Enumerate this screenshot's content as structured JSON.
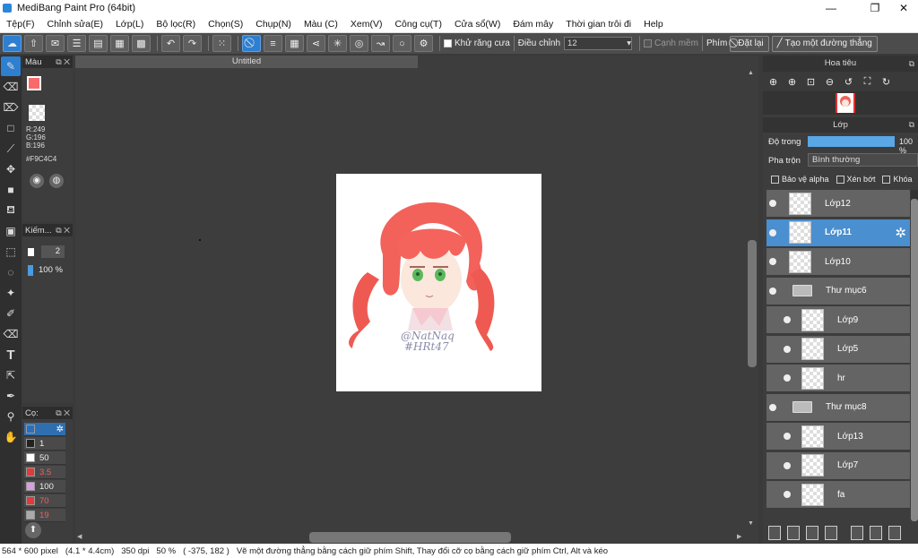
{
  "window": {
    "title": "MediBang Paint Pro (64bit)",
    "minimize": "—",
    "restore": "❐",
    "close": "✕"
  },
  "menu": [
    "Tệp(F)",
    "Chỉnh sửa(E)",
    "Lớp(L)",
    "Bộ lọc(R)",
    "Chọn(S)",
    "Chụp(N)",
    "Màu (C)",
    "Xem(V)",
    "Công cụ(T)",
    "Cửa sổ(W)",
    "Đám mây",
    "Thời gian trôi đi",
    "Help"
  ],
  "toolbar": {
    "antialias_label": "Khử răng cưa",
    "adjust_label": "Điều chỉnh",
    "adjust_value": "12",
    "edge_label": "Cạnh mềm",
    "key_label": "Phím",
    "reset_label": "Đặt lại",
    "make_line_label": "Tạo một đường thẳng"
  },
  "color_panel": {
    "title": "Màu",
    "r": "R:249",
    "g": "G:196",
    "b": "B:196",
    "hex": "#F9C4C4",
    "fg": "#f96a6a",
    "bg": "#3a7fc8"
  },
  "brush_panel": {
    "title": "Kiếm...",
    "size": "2",
    "opacity": "100 %"
  },
  "color_list": {
    "title": "Cọ:",
    "items": [
      {
        "value": "",
        "color": "#2a6fbf"
      },
      {
        "value": "1",
        "color": "#222222"
      },
      {
        "value": "50",
        "color": "#ffffff"
      },
      {
        "value": "3.5",
        "color": "#e03a3a"
      },
      {
        "value": "100",
        "color": "#d6a0e0"
      },
      {
        "value": "70",
        "color": "#e03a3a"
      },
      {
        "value": "19",
        "color": "#aaaaaa"
      }
    ]
  },
  "document": {
    "tab": "Untitled",
    "signature_line1": "@NatNaq",
    "signature_line2": "#HRt47"
  },
  "navigator": {
    "title": "Hoa tiêu"
  },
  "layers": {
    "title": "Lớp",
    "opacity_label": "Độ trong",
    "opacity_value": "100 %",
    "opacity_fraction": 1.0,
    "blend_label": "Pha trộn",
    "blend_value": "Bình thường",
    "protect_alpha": "Bảo vệ alpha",
    "clipping": "Xén bớt",
    "lock": "Khóa",
    "items": [
      {
        "name": "Lớp12",
        "type": "layer",
        "selected": false,
        "child": false
      },
      {
        "name": "Lớp11",
        "type": "layer",
        "selected": true,
        "child": false
      },
      {
        "name": "Lớp10",
        "type": "layer",
        "selected": false,
        "child": false
      },
      {
        "name": "Thư mục6",
        "type": "folder",
        "selected": false,
        "child": false
      },
      {
        "name": "Lớp9",
        "type": "layer",
        "selected": false,
        "child": true
      },
      {
        "name": "Lớp5",
        "type": "layer",
        "selected": false,
        "child": true
      },
      {
        "name": "hr",
        "type": "layer",
        "selected": false,
        "child": true
      },
      {
        "name": "Thư mục8",
        "type": "folder",
        "selected": false,
        "child": false
      },
      {
        "name": "Lớp13",
        "type": "layer",
        "selected": false,
        "child": true
      },
      {
        "name": "Lớp7",
        "type": "layer",
        "selected": false,
        "child": true
      },
      {
        "name": "fa",
        "type": "layer",
        "selected": false,
        "child": true
      }
    ]
  },
  "status": {
    "size": "564 * 600 pixel",
    "cm": "(4.1 * 4.4cm)",
    "dpi": "350 dpi",
    "zoom": "50 %",
    "coords": "( -375, 182 )",
    "hint": "Vẽ một đường thẳng bằng cách giữ phím Shift, Thay đổi cỡ cọ bằng cách giữ phím Ctrl, Alt và kéo"
  }
}
